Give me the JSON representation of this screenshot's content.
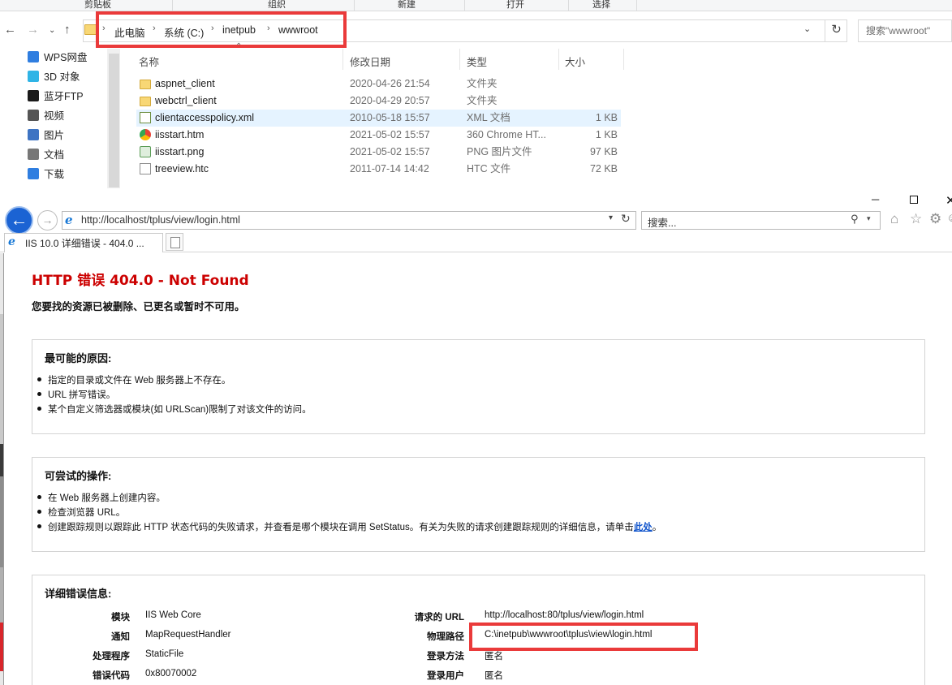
{
  "explorer": {
    "ribbon": [
      "剪贴板",
      "组织",
      "新建",
      "打开",
      "选择"
    ],
    "breadcrumb": [
      "此电脑",
      "系统 (C:)",
      "inetpub",
      "wwwroot"
    ],
    "search_placeholder": "搜索\"wwwroot\"",
    "nav_items": [
      {
        "label": "WPS网盘",
        "icon": "cloud-icon",
        "color": "#2f7ee0"
      },
      {
        "label": "3D 对象",
        "icon": "cube-icon",
        "color": "#2fb4e6"
      },
      {
        "label": "蓝牙FTP",
        "icon": "bluetooth-icon",
        "color": "#1a1a1a"
      },
      {
        "label": "视频",
        "icon": "video-icon",
        "color": "#555555"
      },
      {
        "label": "图片",
        "icon": "picture-icon",
        "color": "#3e74c3"
      },
      {
        "label": "文档",
        "icon": "document-icon",
        "color": "#777777"
      },
      {
        "label": "下载",
        "icon": "download-icon",
        "color": "#2f7ee0"
      }
    ],
    "columns": {
      "name": "名称",
      "modified": "修改日期",
      "type": "类型",
      "size": "大小"
    },
    "files": [
      {
        "name": "aspnet_client",
        "modified": "2020-04-26 21:54",
        "type": "文件夹",
        "size": "",
        "icon": "folder"
      },
      {
        "name": "webctrl_client",
        "modified": "2020-04-29 20:57",
        "type": "文件夹",
        "size": "",
        "icon": "folder"
      },
      {
        "name": "clientaccesspolicy.xml",
        "modified": "2010-05-18 15:57",
        "type": "XML 文档",
        "size": "1 KB",
        "icon": "xml",
        "selected": true
      },
      {
        "name": "iisstart.htm",
        "modified": "2021-05-02 15:57",
        "type": "360 Chrome HT...",
        "size": "1 KB",
        "icon": "chrome"
      },
      {
        "name": "iisstart.png",
        "modified": "2021-05-02 15:57",
        "type": "PNG 图片文件",
        "size": "97 KB",
        "icon": "png"
      },
      {
        "name": "treeview.htc",
        "modified": "2011-07-14 14:42",
        "type": "HTC 文件",
        "size": "72 KB",
        "icon": "file"
      }
    ]
  },
  "browser": {
    "url": "http://localhost/tplus/view/login.html",
    "search_placeholder": "搜索...",
    "tab_title": "IIS 10.0 详细错误 - 404.0 ..."
  },
  "error_page": {
    "title": "HTTP 错误 404.0 - Not Found",
    "subtitle": "您要找的资源已被删除、已更名或暂时不可用。",
    "causes_title": "最可能的原因:",
    "causes": [
      "指定的目录或文件在 Web 服务器上不存在。",
      "URL 拼写错误。",
      "某个自定义筛选器或模块(如 URLScan)限制了对该文件的访问。"
    ],
    "actions_title": "可尝试的操作:",
    "actions": [
      "在 Web 服务器上创建内容。",
      "检查浏览器 URL。",
      "创建跟踪规则以跟踪此 HTTP 状态代码的失败请求，并查看是哪个模块在调用 SetStatus。有关为失败的请求创建跟踪规则的详细信息，请单击"
    ],
    "actions_link": "此处",
    "actions_tail": "。",
    "details_title": "详细错误信息:",
    "details_left": [
      {
        "label": "模块",
        "value": "IIS Web Core"
      },
      {
        "label": "通知",
        "value": "MapRequestHandler"
      },
      {
        "label": "处理程序",
        "value": "StaticFile"
      },
      {
        "label": "错误代码",
        "value": "0x80070002"
      }
    ],
    "details_right": [
      {
        "label": "请求的 URL",
        "value": "http://localhost:80/tplus/view/login.html"
      },
      {
        "label": "物理路径",
        "value": "C:\\inetpub\\wwwroot\\tplus\\view\\login.html"
      },
      {
        "label": "登录方法",
        "value": "匿名"
      },
      {
        "label": "登录用户",
        "value": "匿名"
      }
    ]
  }
}
